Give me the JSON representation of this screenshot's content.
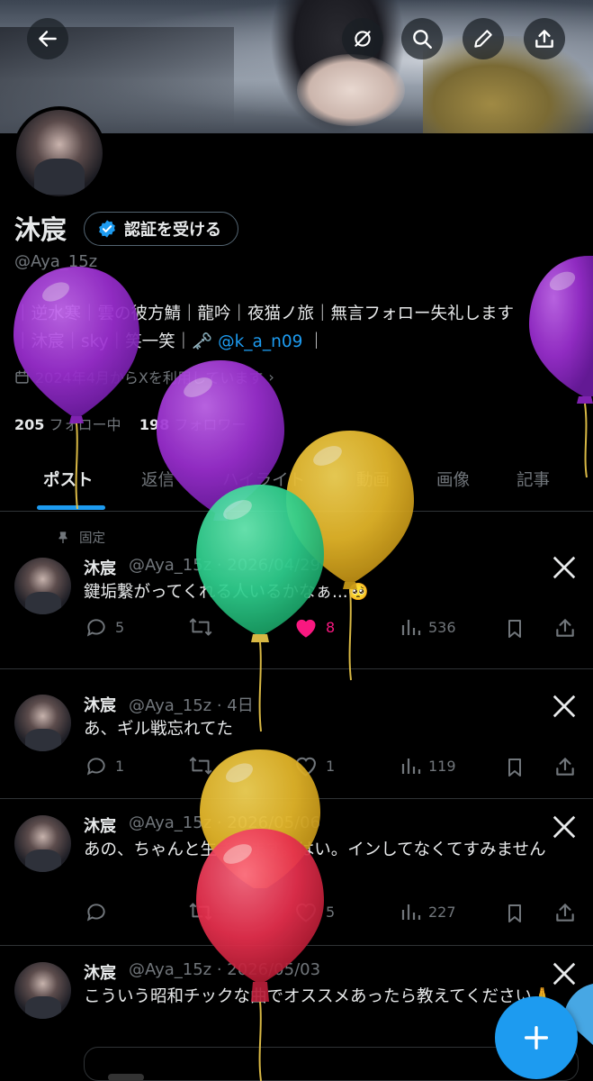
{
  "header": {
    "back_icon": "arrow-left-icon",
    "actions": [
      "grok-slash-icon",
      "search-icon",
      "edit-pencil-icon",
      "share-upload-icon"
    ]
  },
  "profile": {
    "name": "沐宸",
    "verify_label": "認証を受ける",
    "handle": "@Aya_15z",
    "bio_line1_a": "｜逆水寒｜雲の彼方鯖｜龍吟｜夜猫ノ旅｜無言フォロー失礼します",
    "bio_line2_a": "｜沐宸｜sky｜笑一笑｜🗝️",
    "bio_link": "@k_a_n09",
    "bio_line2_b": "｜",
    "joined": "2024年4月からXを利用しています",
    "following_count": "205",
    "following_label": "フォロー中",
    "followers_count": "198",
    "followers_label": "フォロワー"
  },
  "tabs": [
    {
      "label": "ポスト"
    },
    {
      "label": "返信"
    },
    {
      "label": "ハイライト"
    },
    {
      "label": "動画"
    },
    {
      "label": "画像"
    },
    {
      "label": "記事"
    }
  ],
  "pinned_label": "固定",
  "posts": [
    {
      "name": "沐宸",
      "meta": "@Aya_15z · 2026/04/29",
      "text": "鍵垢繋がってくれる人いるかなぁ...🥺",
      "replies": "5",
      "reposts": "",
      "likes": "8",
      "views": "536",
      "liked": true
    },
    {
      "name": "沐宸",
      "meta": "@Aya_15z · 4日",
      "text": "あ、ギル戦忘れてた",
      "replies": "1",
      "reposts": "",
      "likes": "1",
      "views": "119",
      "liked": false
    },
    {
      "name": "沐宸",
      "meta": "@Aya_15z · 2026/05/06",
      "text": "あの、ちゃんと生きてます。はい。インしてなくてすみません",
      "replies": "",
      "reposts": "",
      "likes": "5",
      "views": "227",
      "liked": false
    },
    {
      "name": "沐宸",
      "meta": "@Aya_15z · 2026/05/03",
      "text": "こういう昭和チックな曲でオススメあったら教えてください🙏",
      "replies": "",
      "reposts": "",
      "likes": "",
      "views": "",
      "liked": false
    }
  ],
  "colors": {
    "accent": "#1d9bf0",
    "like": "#f91880",
    "balloon_purple": "#9b2fd0",
    "balloon_yellow": "#e6b82a",
    "balloon_green": "#2fcf8e",
    "balloon_red": "#e8304e"
  },
  "fab_icon": "plus-icon"
}
